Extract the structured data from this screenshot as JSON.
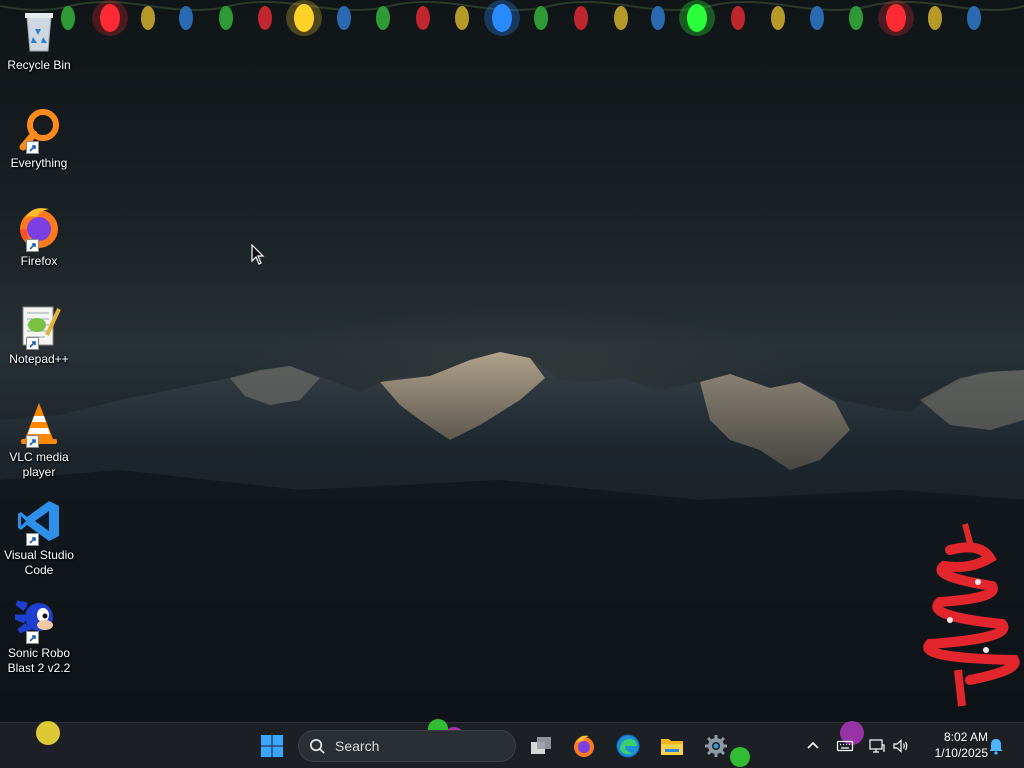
{
  "desktop_icons": [
    {
      "label": "Recycle Bin",
      "icon": "recycle-bin-icon",
      "shortcut": false
    },
    {
      "label": "Everything",
      "icon": "everything-search-icon",
      "shortcut": true
    },
    {
      "label": "Firefox",
      "icon": "firefox-icon",
      "shortcut": true
    },
    {
      "label": "Notepad++",
      "icon": "notepad-plus-plus-icon",
      "shortcut": true
    },
    {
      "label": "VLC media player",
      "icon": "vlc-cone-icon",
      "shortcut": true
    },
    {
      "label": "Visual Studio Code",
      "icon": "vscode-icon",
      "shortcut": true
    },
    {
      "label": "Sonic Robo Blast 2 v2.2",
      "icon": "sonic-icon",
      "shortcut": true
    }
  ],
  "taskbar": {
    "search_placeholder": "Search",
    "pinned": [
      "start-icon",
      "task-view-icon",
      "firefox-icon",
      "edge-icon",
      "file-explorer-icon",
      "settings-gear-icon"
    ],
    "tray": {
      "time": "8:02 AM",
      "date": "1/10/2025",
      "icons": [
        "chevron-up-icon",
        "keyboard-icon",
        "network-icon",
        "volume-icon",
        "notification-bell-icon"
      ]
    }
  },
  "colors": {
    "taskbar_bg": "#1c2024",
    "accent_blue": "#3a9bdc",
    "light_red": "#e8262d",
    "light_green": "#2fbf3a",
    "light_yellow": "#e8c12a",
    "light_blue": "#2a7fe0"
  }
}
